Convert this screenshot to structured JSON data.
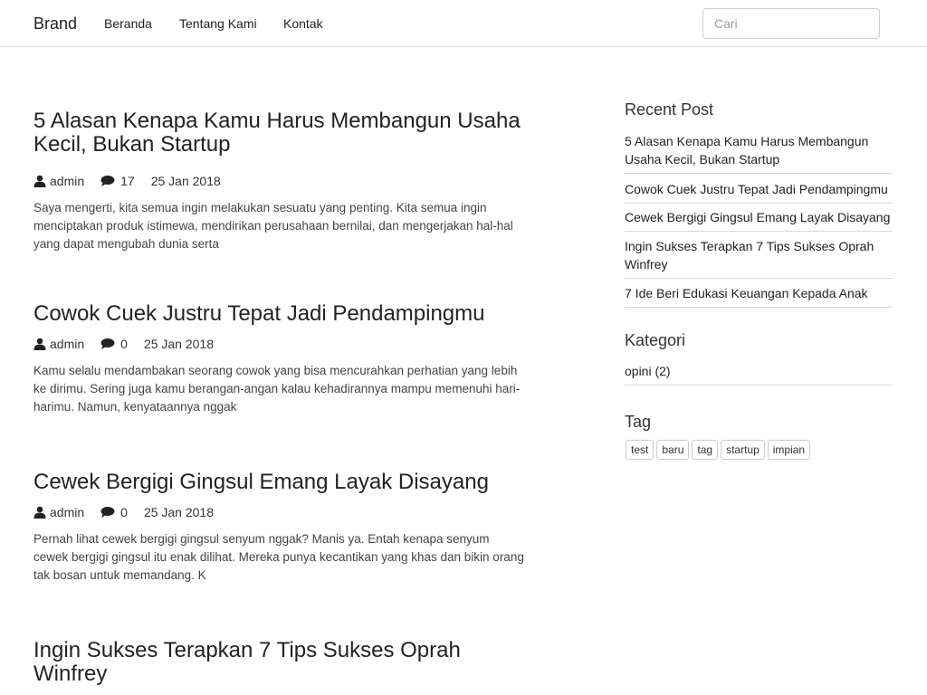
{
  "navbar": {
    "brand": "Brand",
    "links": [
      "Beranda",
      "Tentang Kami",
      "Kontak"
    ],
    "search_placeholder": "Cari"
  },
  "posts": [
    {
      "title": "5 Alasan Kenapa Kamu Harus Membangun Usaha Kecil, Bukan Startup",
      "author": "admin",
      "comments": "17",
      "date": "25 Jan 2018",
      "excerpt": "Saya mengerti, kita semua ingin melakukan sesuatu yang penting. Kita semua ingin menciptakan produk istimewa, mendirikan perusahaan bernilai, dan mengerjakan hal-hal yang dapat mengubah dunia serta"
    },
    {
      "title": "Cowok Cuek Justru Tepat Jadi Pendampingmu",
      "author": "admin",
      "comments": "0",
      "date": "25 Jan 2018",
      "excerpt": "Kamu selalu mendambakan seorang cowok yang bisa mencurahkan perhatian yang lebih ke dirimu. Sering juga kamu berangan-angan kalau kehadirannya mampu memenuhi hari-harimu. Namun, kenyataannya nggak"
    },
    {
      "title": "Cewek Bergigi Gingsul Emang Layak Disayang",
      "author": "admin",
      "comments": "0",
      "date": "25 Jan 2018",
      "excerpt": "Pernah lihat cewek bergigi gingsul senyum nggak? Manis ya. Entah kenapa senyum cewek bergigi gingsul itu enak dilihat. Mereka punya kecantikan yang khas dan bikin orang tak bosan untuk memandang. K"
    },
    {
      "title": "Ingin Sukses Terapkan 7 Tips Sukses Oprah Winfrey"
    }
  ],
  "sidebar": {
    "recent_title": "Recent Post",
    "recent_posts": [
      "5 Alasan Kenapa Kamu Harus Membangun Usaha Kecil, Bukan Startup",
      "Cowok Cuek Justru Tepat Jadi Pendampingmu",
      "Cewek Bergigi Gingsul Emang Layak Disayang",
      "Ingin Sukses Terapkan 7 Tips Sukses Oprah Winfrey",
      "7 Ide Beri Edukasi Keuangan Kepada Anak"
    ],
    "category_title": "Kategori",
    "categories": [
      "opini (2)"
    ],
    "tag_title": "Tag",
    "tags": [
      "test",
      "baru",
      "tag",
      "startup",
      "impian"
    ]
  },
  "icons": {
    "author": "user-icon",
    "comments": "comment-icon"
  }
}
